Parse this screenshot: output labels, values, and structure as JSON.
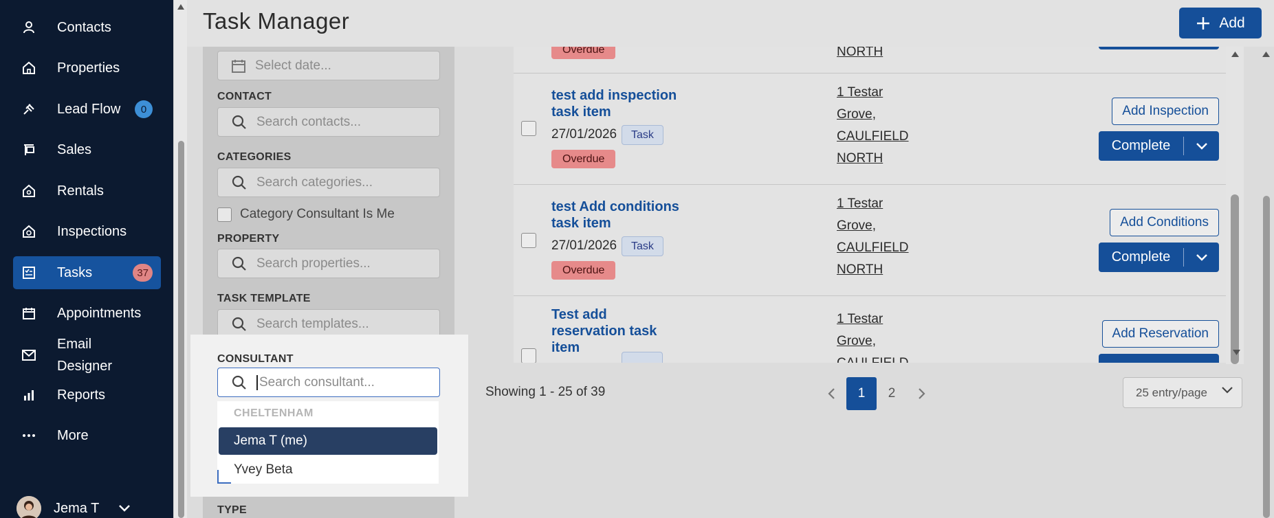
{
  "sidebar": {
    "items": [
      {
        "label": "Contacts",
        "icon": "user-icon"
      },
      {
        "label": "Properties",
        "icon": "home-icon"
      },
      {
        "label": "Lead Flow",
        "icon": "lead-flow-icon",
        "badge": "0"
      },
      {
        "label": "Sales",
        "icon": "sales-sign-icon"
      },
      {
        "label": "Rentals",
        "icon": "rentals-home-icon"
      },
      {
        "label": "Inspections",
        "icon": "inspection-icon"
      },
      {
        "label": "Tasks",
        "icon": "tasks-icon",
        "badge": "37"
      },
      {
        "label": "Appointments",
        "icon": "calendar-icon"
      },
      {
        "label": "Email Designer",
        "icon": "mail-icon"
      },
      {
        "label": "Reports",
        "icon": "bar-chart-icon"
      },
      {
        "label": "More",
        "icon": "ellipsis-icon"
      }
    ],
    "user": {
      "name": "Jema T"
    }
  },
  "header": {
    "title": "Task Manager",
    "add_label": "Add"
  },
  "filters": {
    "date_placeholder": "Select date...",
    "contact_label": "CONTACT",
    "contact_placeholder": "Search contacts...",
    "categories_label": "CATEGORIES",
    "categories_placeholder": "Search categories...",
    "category_consultant_label": "Category Consultant Is Me",
    "property_label": "PROPERTY",
    "property_placeholder": "Search properties...",
    "template_label": "TASK TEMPLATE",
    "template_placeholder": "Search templates...",
    "consultant_label": "CONSULTANT",
    "consultant_placeholder": "Search consultant...",
    "consultant_group": "CHELTENHAM",
    "consultant_options": [
      "Jema T (me)",
      "Yvey Beta"
    ],
    "type_label": "TYPE"
  },
  "tasks": {
    "partial_top": {
      "tag": "Overdue",
      "address_line": "NORTH"
    },
    "rows": [
      {
        "title": "test add inspection task item",
        "date": "27/01/2026",
        "tag": "Task",
        "status": "Overdue",
        "address": [
          "1 Testar",
          "Grove,",
          "CAULFIELD",
          "NORTH"
        ],
        "action": "Add Inspection",
        "complete": "Complete"
      },
      {
        "title": "test Add conditions task item",
        "date": "27/01/2026",
        "tag": "Task",
        "status": "Overdue",
        "address": [
          "1 Testar",
          "Grove,",
          "CAULFIELD",
          "NORTH"
        ],
        "action": "Add Conditions",
        "complete": "Complete"
      },
      {
        "title": "Test add reservation task item",
        "address": [
          "1 Testar",
          "Grove,",
          "CAULFIELD"
        ],
        "action": "Add Reservation"
      }
    ]
  },
  "pagination": {
    "showing": "Showing 1 - 25 of 39",
    "pages": [
      "1",
      "2"
    ],
    "current": "1",
    "per_page": "25 entry/page"
  },
  "colors": {
    "sidebar_bg": "#0c1a30",
    "accent": "#154f99",
    "overdue": "#e68a8a"
  }
}
